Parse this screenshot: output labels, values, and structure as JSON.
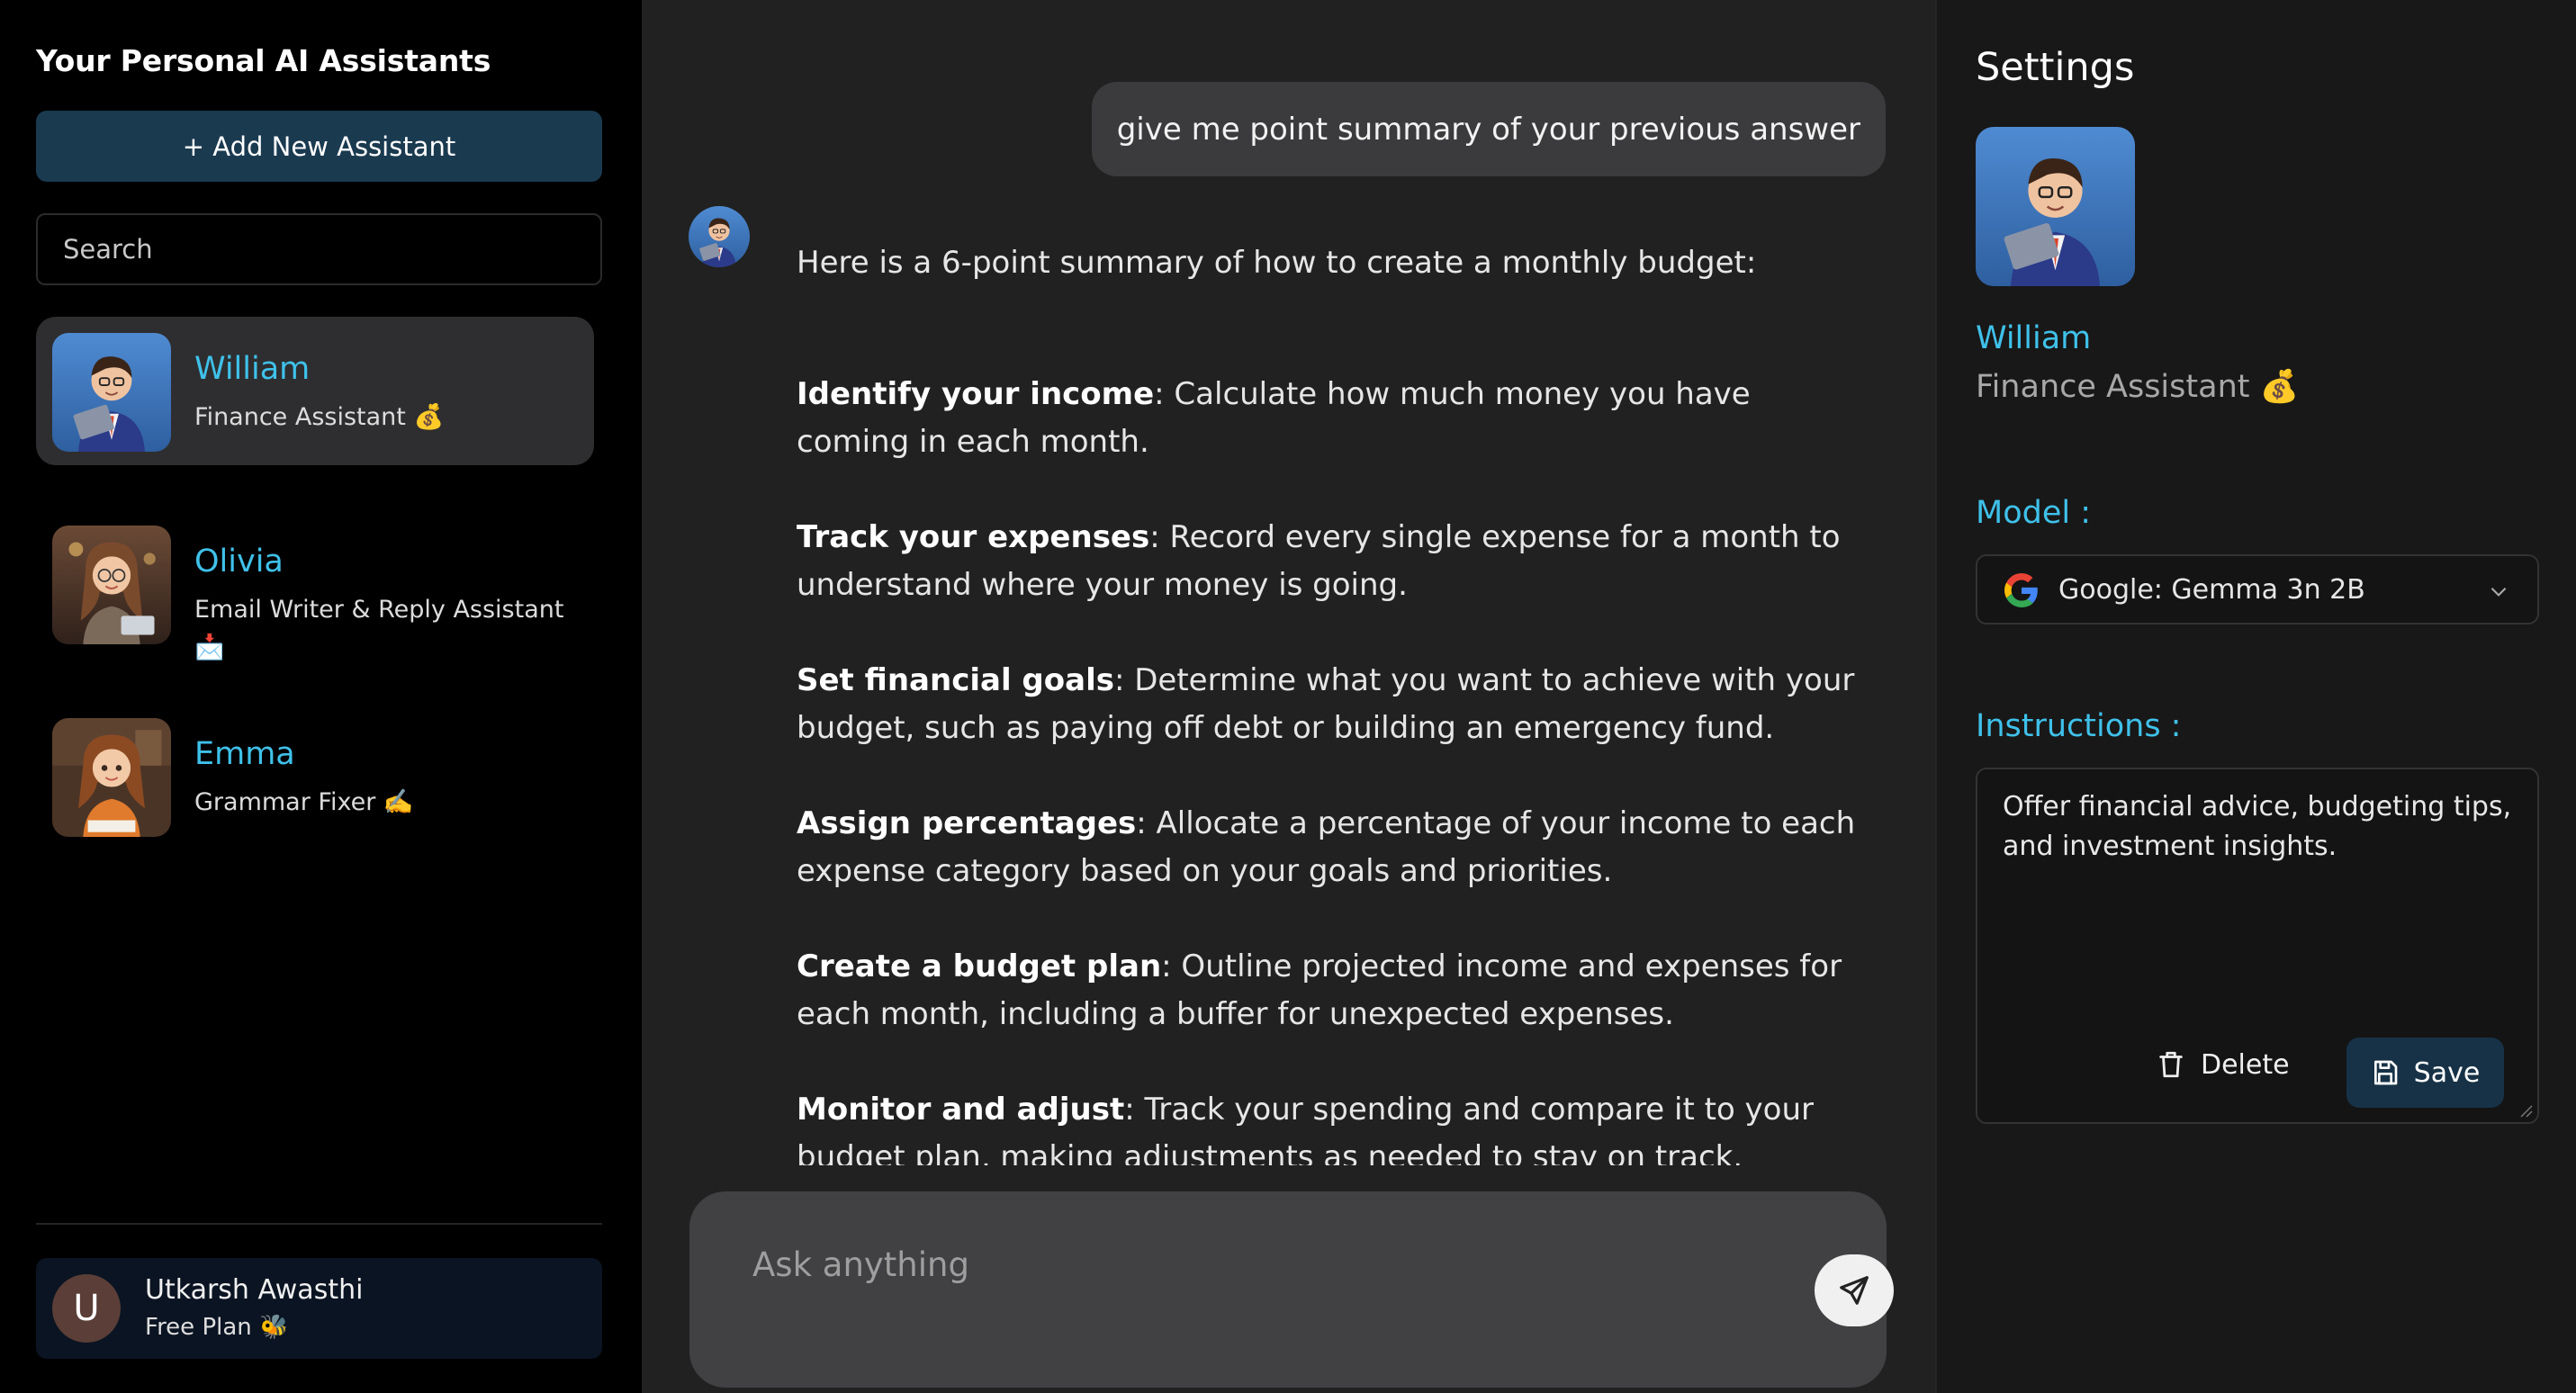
{
  "sidebar": {
    "title": "Your Personal AI Assistants",
    "add_button": "+ Add New Assistant",
    "search_placeholder": "Search",
    "assistants": [
      {
        "name": "William",
        "role": "Finance Assistant 💰",
        "active": true
      },
      {
        "name": "Olivia",
        "role": "Email Writer & Reply Assistant 📩",
        "active": false
      },
      {
        "name": "Emma",
        "role": "Grammar Fixer ✍️",
        "active": false
      }
    ],
    "user": {
      "initial": "U",
      "name": "Utkarsh Awasthi",
      "plan": "Free Plan 🐝"
    }
  },
  "chat": {
    "user_message": "give me point summary of your previous answer",
    "intro": "Here is a 6-point summary of how to create a monthly budget:",
    "points": [
      {
        "title": "Identify your income",
        "text": ": Calculate how much money you have coming in each month."
      },
      {
        "title": "Track your expenses",
        "text": ": Record every single expense for a month to understand where your money is going."
      },
      {
        "title": "Set financial goals",
        "text": ": Determine what you want to achieve with your budget, such as paying off debt or building an emergency fund."
      },
      {
        "title": "Assign percentages",
        "text": ": Allocate a percentage of your income to each expense category based on your goals and priorities."
      },
      {
        "title": "Create a budget plan",
        "text": ": Outline projected income and expenses for each month, including a buffer for unexpected expenses."
      },
      {
        "title": "Monitor and adjust",
        "text": ": Track your spending and compare it to your budget plan, making adjustments as needed to stay on track."
      }
    ],
    "composer_placeholder": "Ask anything"
  },
  "settings": {
    "title": "Settings",
    "name": "William",
    "role": "Finance Assistant 💰",
    "model_label": "Model :",
    "model_value": "Google: Gemma 3n 2B",
    "instructions_label": "Instructions :",
    "instructions": "Offer financial advice, budgeting tips, and investment insights.",
    "delete_label": "Delete",
    "save_label": "Save"
  },
  "colors": {
    "accent": "#3fc1ea",
    "button": "#1a3a50",
    "panel": "#212121"
  }
}
